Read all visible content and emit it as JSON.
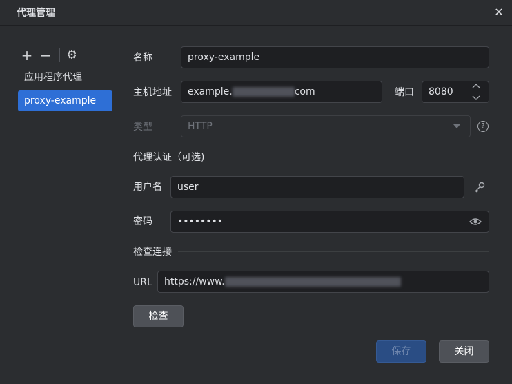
{
  "window": {
    "title": "代理管理",
    "close_glyph": "✕"
  },
  "sidebar": {
    "toolbar": {
      "add_glyph": "+",
      "remove_glyph": "−",
      "settings_glyph": "⚙"
    },
    "items": [
      {
        "label": "应用程序代理",
        "selected": false
      },
      {
        "label": "proxy-example",
        "selected": true
      }
    ]
  },
  "form": {
    "name": {
      "label": "名称",
      "value": "proxy-example"
    },
    "host": {
      "label": "主机地址",
      "value_prefix": "example.",
      "value_suffix": "com"
    },
    "port": {
      "label": "端口",
      "value": "8080"
    },
    "type": {
      "label": "类型",
      "value": "HTTP",
      "help_glyph": "?"
    },
    "auth_section": {
      "title": "代理认证（可选)"
    },
    "username": {
      "label": "用户名",
      "value": "user"
    },
    "password": {
      "label": "密码",
      "value": "••••••••"
    },
    "check_section": {
      "title": "检查连接"
    },
    "url": {
      "label": "URL",
      "value_prefix": "https://www."
    },
    "check_button": "检查"
  },
  "footer": {
    "save_label": "保存",
    "close_label": "关闭"
  },
  "colors": {
    "background": "#2b2d30",
    "field": "#1e1f22",
    "accent": "#2e6fd6",
    "disabled_primary": "#2a4d84"
  }
}
